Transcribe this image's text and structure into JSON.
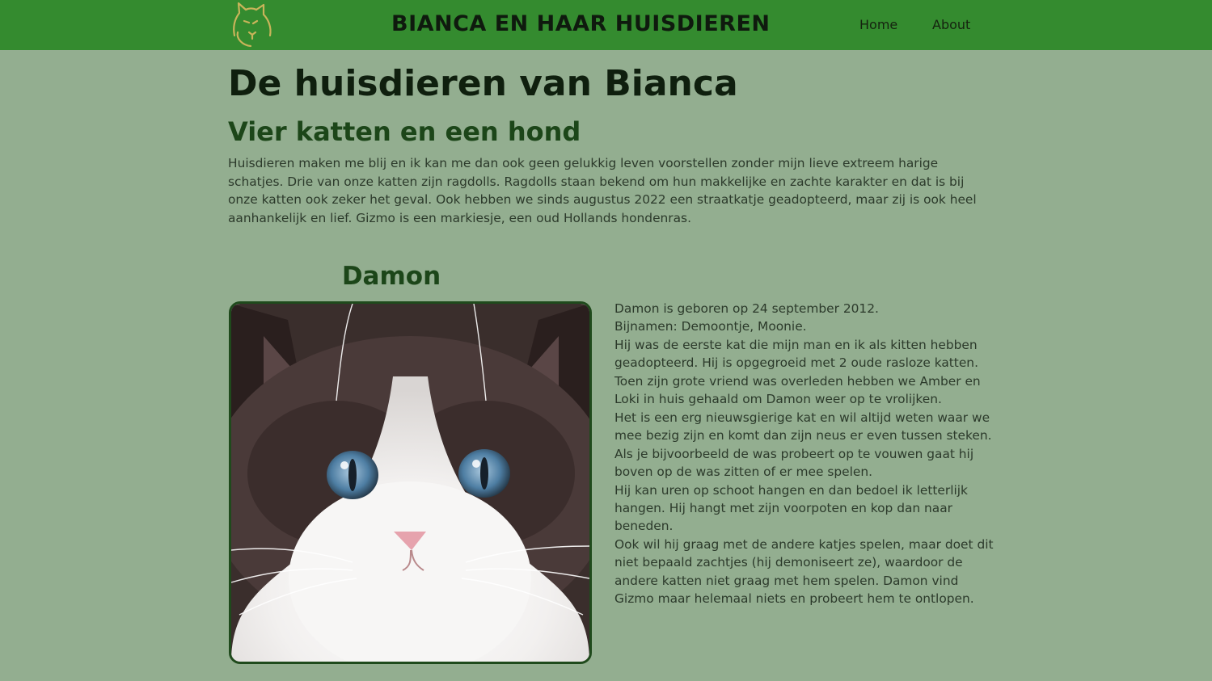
{
  "header": {
    "site_title": "BIANCA EN HAAR HUISDIEREN",
    "nav": [
      {
        "label": "Home"
      },
      {
        "label": "About"
      }
    ],
    "logo_icon": "cat-head-icon",
    "bar_color": "#348b2f"
  },
  "main": {
    "title": "De huisdieren van Bianca",
    "subtitle": "Vier katten en een hond",
    "intro": "Huisdieren maken me blij en ik kan me dan ook geen gelukkig leven voorstellen zonder mijn lieve extreem harige schatjes. Drie van onze katten zijn ragdolls. Ragdolls staan bekend om hun makkelijke en zachte karakter en dat is bij onze katten ook zeker het geval. Ook hebben we sinds augustus 2022 een straatkatje geadopteerd, maar zij is ook heel aanhankelijk en lief. Gizmo is een markiesje, een oud Hollands hondenras."
  },
  "pet": {
    "name": "Damon",
    "lines": [
      "Damon is geboren op 24 september 2012.",
      "Bijnamen: Demoontje, Moonie.",
      "Hij was de eerste kat die mijn man en ik als kitten hebben geadopteerd. Hij is opgegroeid met 2 oude rasloze katten.",
      "Toen zijn grote vriend was overleden hebben we Amber en Loki in huis gehaald om Damon weer op te vrolijken.",
      "Het is een erg nieuwsgierige kat en wil altijd weten waar we mee bezig zijn en komt dan zijn neus er even tussen steken. Als je bijvoorbeeld de was probeert op te vouwen gaat hij boven op de was zitten of er mee spelen.",
      "Hij kan uren op schoot hangen en dan bedoel ik letterlijk hangen. Hij hangt met zijn voorpoten en kop dan naar beneden.",
      "Ook wil hij graag met de andere katjes spelen, maar doet dit niet bepaald zachtjes (hij demoniseert ze), waardoor de andere katten niet graag met hem spelen. Damon vind Gizmo maar helemaal niets en probeert hem te ontlopen."
    ]
  },
  "colors": {
    "background": "#93ae90",
    "heading_dark": "#0f1f0e",
    "heading_green": "#1c4619"
  }
}
